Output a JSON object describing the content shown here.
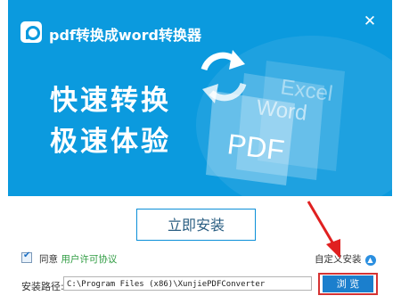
{
  "window": {
    "title": "pdf转换成word转换器",
    "close_glyph": "✕"
  },
  "banner": {
    "slogan_line1": "快速转换",
    "slogan_line2": "极速体验",
    "graphic_words": [
      "PDF",
      "Word",
      "Excel"
    ]
  },
  "actions": {
    "install_label": "立即安装",
    "custom_install_label": "自定义安装",
    "browse_label": "浏 览"
  },
  "agreement": {
    "checked": true,
    "agree_label": "同意",
    "license_link": "用户许可协议"
  },
  "install_path": {
    "label": "安装路径:",
    "value": "C:\\Program Files (x86)\\XunjiePDFConverter"
  },
  "colors": {
    "banner_bg": "#0b9ade",
    "link_green": "#2f9c42",
    "browse_bg": "#1b7fcd",
    "highlight_red": "#d53333"
  }
}
